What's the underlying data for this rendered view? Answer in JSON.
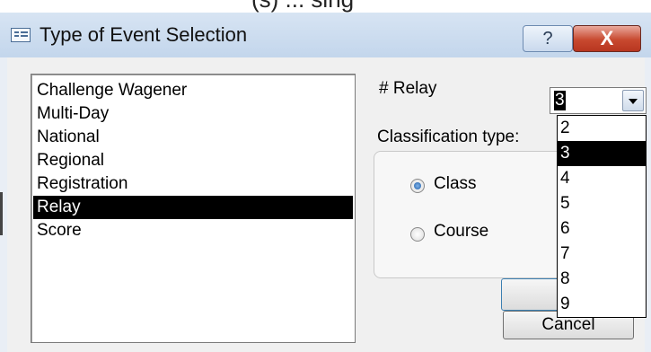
{
  "top_strip": {
    "text": "(s) ... sing"
  },
  "window": {
    "title": "Type of Event Selection",
    "help_label": "?",
    "close_label": "X"
  },
  "event_list": {
    "items": [
      "Challenge Wagener",
      "Multi-Day",
      "National",
      "Regional",
      "Registration",
      "Relay",
      "Score"
    ],
    "selected": "Relay"
  },
  "relay": {
    "label": "# Relay",
    "value": "3",
    "options": [
      "2",
      "3",
      "4",
      "5",
      "6",
      "7",
      "8",
      "9"
    ],
    "selected": "3"
  },
  "classification": {
    "label": "Classification type:",
    "options": [
      "Class",
      "Course"
    ],
    "selected": "Class"
  },
  "buttons": {
    "ok": "",
    "cancel": "Cancel"
  },
  "colors": {
    "selection": "#000000",
    "close_red": "#c8492f",
    "title_blue": "#c3d6ec"
  }
}
